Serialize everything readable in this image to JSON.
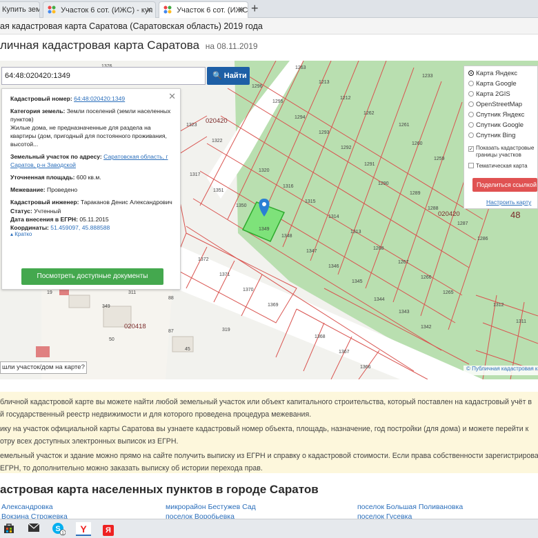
{
  "browser": {
    "tabs": [
      {
        "label": "Купить земел"
      },
      {
        "label": "Участок 6 сот. (ИЖС) - куп"
      },
      {
        "label": "Участок 6 сот. (ИЖС) - куп"
      }
    ],
    "new_tab": "+",
    "window_title": "ая кадастровая карта Саратова (Саратовская область) 2019 года"
  },
  "page": {
    "heading": "личная кадастровая карта Саратова",
    "date": "на 08.11.2019"
  },
  "search": {
    "value": "64:48:020420:1349",
    "button": "Найти"
  },
  "info": {
    "cadastral_label": "Кадастровый номер:",
    "cadastral_value": "64:48:020420:1349",
    "category_label": "Категория земель:",
    "category_value": "Земли поселений (земли населенных пунктов)",
    "usage_value": "Жилые дома, не предназначенные для раздела на квартиры (дом, пригодный для постоянного проживания, высотой...",
    "address_label": "Земельный участок по адресу:",
    "address_value": "Саратовская область, г Саратов, р-н Заводской",
    "area_label": "Уточненная площадь:",
    "area_value": "600 кв.м.",
    "survey_label": "Межевание:",
    "survey_value": "Проведено",
    "engineer_label": "Кадастровый инженер:",
    "engineer_value": "Тараканов Денис Александрович",
    "status_label": "Статус:",
    "status_value": "Учтенный",
    "date_label": "Дата внесения в ЕГРН:",
    "date_value": "05.11.2015",
    "coords_label": "Координаты:",
    "coords_value": "51.459097, 45.888588",
    "less_link": "Кратко",
    "docs_button": "Посмотреть доступные документы"
  },
  "layers": {
    "options": [
      {
        "label": "Карта Яндекс",
        "selected": true
      },
      {
        "label": "Карта Google",
        "selected": false
      },
      {
        "label": "Карта 2GIS",
        "selected": false
      },
      {
        "label": "OpenStreetMap",
        "selected": false
      },
      {
        "label": "Спутник Яндекс",
        "selected": false
      },
      {
        "label": "Спутник Google",
        "selected": false
      },
      {
        "label": "Спутник Bing",
        "selected": false
      }
    ],
    "show_boundaries": "Показать кадастровые границы участков",
    "thematic": "Тематическая карта",
    "share_button": "Поделиться ссылкой",
    "setup_link": "Настроить карту"
  },
  "map": {
    "lost_button": "шли участок/дом на карте?",
    "attribution": "© Публичная кадастровая ка",
    "labels": {
      "q1": "020420",
      "q2": "020420",
      "q3": "020418",
      "n48": "48",
      "parcels": [
        "1376",
        "1263",
        "1213",
        "1233",
        "1296",
        "1295",
        "1212",
        "1323",
        "1294",
        "1262",
        "1261",
        "1322",
        "1293",
        "1260",
        "1292",
        "1259",
        "1320",
        "1291",
        "1290",
        "1317",
        "1316",
        "1289",
        "1351",
        "1315",
        "1288",
        "1287",
        "1350",
        "1314",
        "1349",
        "1348",
        "1313",
        "1286",
        "1347",
        "1268",
        "1372",
        "1346",
        "1267",
        "1371",
        "1345",
        "1266",
        "1370",
        "1344",
        "1265",
        "1369",
        "1343",
        "1342",
        "1368",
        "1367",
        "1366",
        "1312",
        "1311",
        "311",
        "88",
        "349",
        "87",
        "50",
        "319",
        "45",
        "19"
      ]
    }
  },
  "description": {
    "lines": [
      "бличной кадастровой карте вы можете найти любой земельный участок или объект капитального строительства, который поставлен на кадастровый учёт в",
      "й государственный реестр недвижимости и для которого проведена процедура межевания.",
      "ику на участок официальной карты Саратова вы узнаете кадастровый номер объекта, площадь, назначение, год постройки (для дома) и можете перейти к",
      "отру всех доступных электронных выписок из ЕГРН.",
      "емельный участок и здание можно прямо на сайте получить выписку из ЕГРН и справку о кадастровой стоимости. Если права собственности зарегистрированы в",
      "ЕГРН, то дополнительно можно заказать выписку об истории перехода прав."
    ]
  },
  "section": {
    "title": "астровая карта населенных пунктов в городе Саратов",
    "links": [
      "Александровка",
      "микрорайон Бестужев Сад",
      "поселок Большая Поливановка",
      "Вокзина Строжевка",
      "поселок Воробьевка",
      "поселок Гусевка"
    ]
  },
  "taskbar": {
    "icons": [
      "store-icon",
      "mail-icon",
      "skype-icon",
      "yandex-browser-icon",
      "yandex-icon"
    ],
    "skype_badge": "1"
  },
  "colors": {
    "accent_blue": "#1e5fa6",
    "green_button": "#44a84e",
    "share_red": "#e05252",
    "parcel_line": "#d9534f",
    "green_area": "#b9dfb0",
    "selected_parcel": "#7ee27a",
    "desc_bg": "#fdf7dc"
  }
}
